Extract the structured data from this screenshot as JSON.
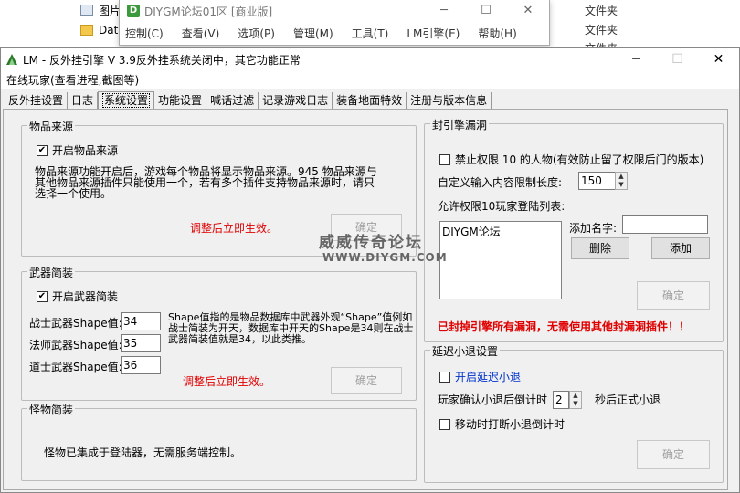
{
  "background": {
    "explorer_items": [
      {
        "label": "图片",
        "type": "文件夹"
      },
      {
        "label": "Dat",
        "type": "文件夹"
      },
      {
        "label": "",
        "type": "文件夹"
      }
    ],
    "window": {
      "title": "DIYGM论坛01区 [商业版]",
      "menu": [
        "控制(C)",
        "查看(V)",
        "选项(P)",
        "管理(M)",
        "工具(T)",
        "LM引擎(E)",
        "帮助(H)"
      ]
    }
  },
  "window": {
    "title": "LM - 反外挂引擎 V 3.9反外挂系统关闭中，其它功能正常",
    "menu_item": "在线玩家(查看进程,截图等)"
  },
  "tabs": [
    "反外挂设置",
    "日志",
    "系统设置",
    "功能设置",
    "喊话过滤",
    "记录游戏日志",
    "装备地面特效",
    "注册与版本信息"
  ],
  "active_tab": "系统设置",
  "item_source": {
    "legend": "物品来源",
    "checkbox_label": "开启物品来源",
    "checked": true,
    "description": "物品来源功能开启后，游戏每个物品将显示物品来源。945 物品来源与其他物品来源插件只能使用一个，若有多个插件支持物品来源时，请只选择一个使用。",
    "notice": "调整后立即生效。",
    "confirm": "确定"
  },
  "weapon_simplify": {
    "legend": "武器简装",
    "checkbox_label": "开启武器简装",
    "checked": true,
    "fields": [
      {
        "label": "战士武器Shape值:",
        "value": "34"
      },
      {
        "label": "法师武器Shape值:",
        "value": "35"
      },
      {
        "label": "道士武器Shape值:",
        "value": "36"
      }
    ],
    "description": "Shape值指的是物品数据库中武器外观“Shape”值例如战士简装为开天，数据库中开天的Shape是34则在战士武器简装值就是34，以此类推。",
    "notice": "调整后立即生效。",
    "confirm": "确定"
  },
  "monster_simplify": {
    "legend": "怪物简装",
    "description": "怪物已集成于登陆器，无需服务端控制。"
  },
  "engine_hole": {
    "legend": "封引擎漏洞",
    "checkbox_label": "禁止权限 10 的人物(有效防止留了权限后门的版本)",
    "checked": false,
    "max_len_label": "自定义输入内容限制长度:",
    "max_len_value": "150",
    "allow_list_label": "允许权限10玩家登陆列表:",
    "allow_list": [
      "DIYGM论坛"
    ],
    "add_name_label": "添加名字:",
    "add_name_value": "",
    "delete": "删除",
    "add": "添加",
    "confirm": "确定",
    "notice": "已封掉引擎所有漏洞，无需使用其他封漏洞插件！！"
  },
  "delay_logout": {
    "legend": "延迟小退设置",
    "enable_label": "开启延迟小退",
    "enable_checked": false,
    "countdown_prefix": "玩家确认小退后倒计时",
    "countdown_value": "2",
    "countdown_suffix": "秒后正式小退",
    "move_label": "移动时打断小退倒计时",
    "move_checked": false,
    "confirm": "确定"
  },
  "watermark": {
    "line1": "威威传奇论坛",
    "line2": "WWW.DIYGM.COM"
  }
}
